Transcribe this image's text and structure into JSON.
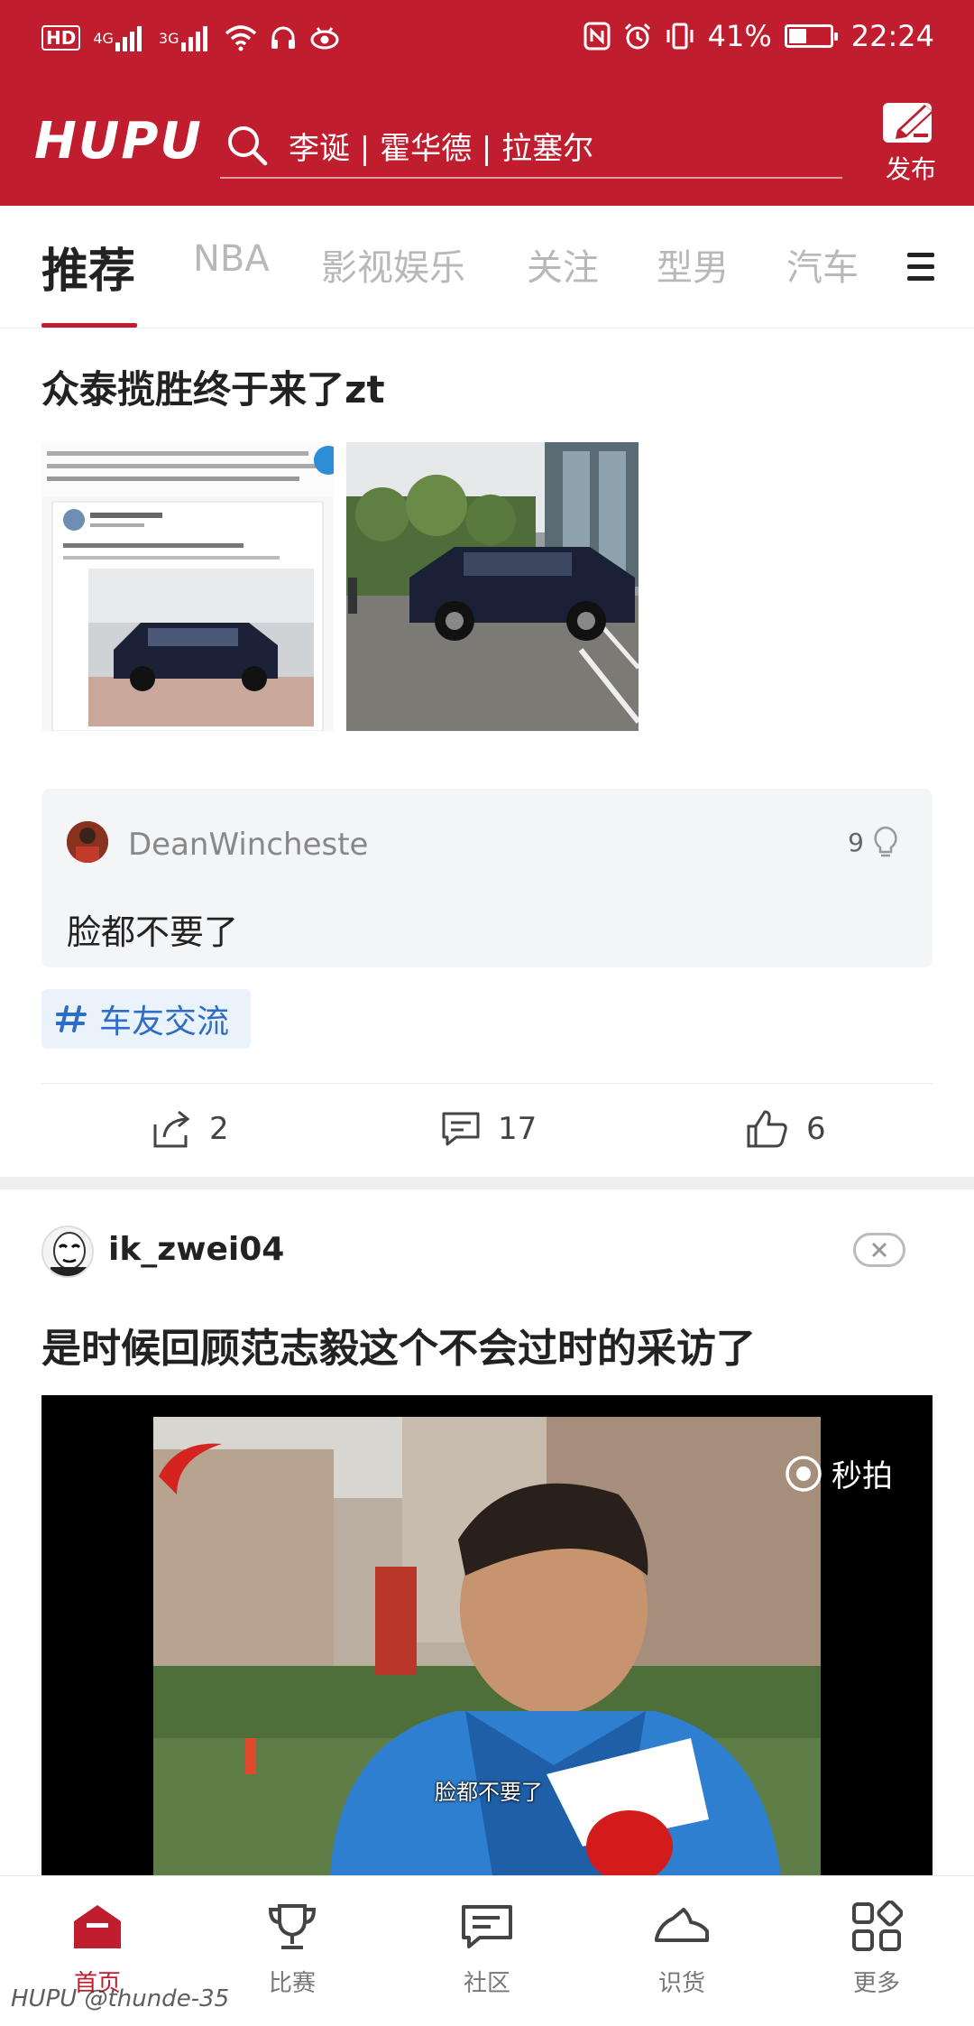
{
  "status_bar": {
    "left_label": "HD",
    "net1": "4G",
    "net2": "3G",
    "battery": "41%",
    "time": "22:24"
  },
  "header": {
    "logo": "HUPU",
    "search_text": "李诞 | 霍华德 | 拉塞尔",
    "publish_label": "发布"
  },
  "tabs": [
    "推荐",
    "NBA",
    "影视娱乐",
    "关注",
    "型男",
    "汽车"
  ],
  "post1": {
    "title": "众泰揽胜终于来了zt",
    "comment": {
      "user": "DeanWincheste",
      "likes": "9",
      "text": "脸都不要了"
    },
    "topic_tag": "车友交流",
    "actions": {
      "share": "2",
      "comments": "17",
      "likes": "6"
    }
  },
  "post2": {
    "user": "ik_zwei04",
    "title": "是时候回顾范志毅这个不会过时的采访了",
    "video_watermark": "秒拍",
    "video_subtitle": "脸都不要了"
  },
  "bottom_nav": [
    {
      "label": "首页",
      "icon": "home-icon"
    },
    {
      "label": "比赛",
      "icon": "trophy-icon"
    },
    {
      "label": "社区",
      "icon": "chat-icon"
    },
    {
      "label": "识货",
      "icon": "sneaker-icon"
    },
    {
      "label": "更多",
      "icon": "grid-icon"
    }
  ],
  "footer_watermark": "HUPU @thunde-35",
  "colors": {
    "brand_red": "#c01e2f",
    "tag_blue": "#2e6cc6"
  }
}
